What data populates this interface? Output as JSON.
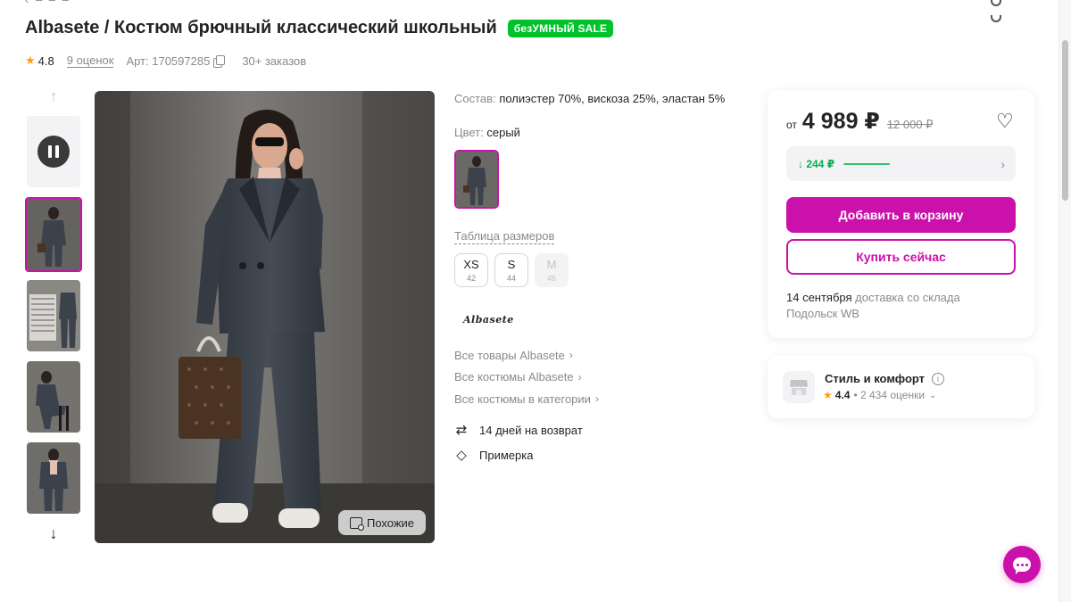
{
  "product": {
    "title": "Albasete / Костюм брючный классический школьный",
    "sale_badge": "безУМНЫЙ SALE",
    "rating": "4.8",
    "reviews": "9 оценок",
    "article": "Арт: 170597285",
    "orders": "30+ заказов"
  },
  "gallery": {
    "similar_label": "Похожие"
  },
  "details": {
    "composition_label": "Состав:",
    "composition_value": "полиэстер 70%, вискоза 25%, эластан 5%",
    "color_label": "Цвет:",
    "color_value": "серый",
    "size_table_link": "Таблица размеров",
    "sizes": [
      {
        "name": "XS",
        "num": "42",
        "available": true
      },
      {
        "name": "S",
        "num": "44",
        "available": true
      },
      {
        "name": "M",
        "num": "46",
        "available": false
      }
    ],
    "brand_logo": "Albasete",
    "brand_links": [
      "Все товары Albasete",
      "Все костюмы Albasete",
      "Все костюмы в категории"
    ],
    "features": [
      "14 дней на возврат",
      "Примерка"
    ]
  },
  "price_card": {
    "from": "от",
    "price": "4 989 ₽",
    "old_price": "12 000 ₽",
    "wallet": "↓ 244 ₽",
    "add_to_cart": "Добавить в корзину",
    "buy_now": "Купить сейчас",
    "delivery_date": "14 сентября",
    "delivery_rest": "доставка со склада Подольск WB"
  },
  "seller": {
    "name": "Стиль и комфорт",
    "rating": "4.4",
    "reviews": "• 2 434 оценки"
  },
  "colors": {
    "accent": "#cb11ab",
    "sale_green": "#00c22a",
    "wallet_green": "#00b14f",
    "star": "#ff9f0a"
  }
}
